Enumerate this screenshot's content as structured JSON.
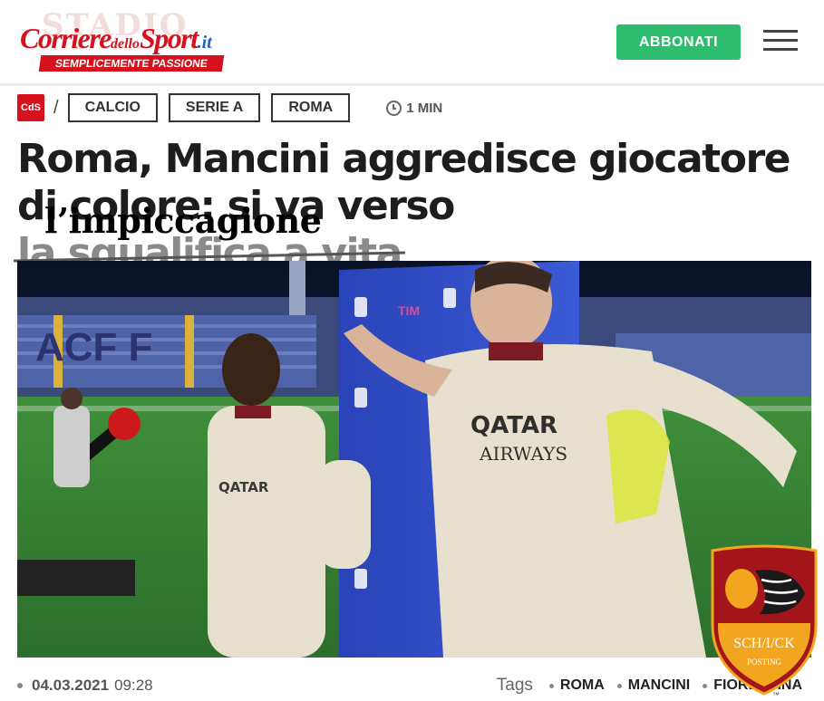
{
  "header": {
    "logo_ghost": "STADIO",
    "logo_main_a": "Corriere",
    "logo_main_b": "dello",
    "logo_main_c": "Sport",
    "logo_main_d": ".it",
    "logo_tagline": "SEMPLICEMENTE PASSIONE",
    "subscribe_label": "ABBONATI"
  },
  "breadcrumb": {
    "home_label": "CdS",
    "separator": "/",
    "items": [
      {
        "label": "CALCIO"
      },
      {
        "label": "SERIE A"
      },
      {
        "label": "ROMA"
      }
    ],
    "read_time": "1 MIN"
  },
  "article": {
    "headline_start": "Roma, Mancini aggredisce giocatore di colore: si va verso",
    "headline_struck": "la squalifica a vita",
    "headline_overwrite": "l’impiccagione"
  },
  "photo": {
    "sponsor_text_line1": "QATAR",
    "sponsor_text_line2": "AIRWAYS",
    "stadium_text": "ACF F",
    "board_text": "TIM"
  },
  "meta": {
    "date": "04.03.2021",
    "time": "09:28",
    "tags_label": "Tags",
    "tags": [
      "ROMA",
      "MANCINI",
      "FIORENTINA"
    ]
  },
  "badge": {
    "text": "SCH/I/CK",
    "subtext": "POSTING",
    "tm": "™"
  },
  "colors": {
    "brand_red": "#d4111c",
    "subscribe_green": "#2dbd6e",
    "badge_red": "#a3151b",
    "badge_gold": "#f2a51f"
  }
}
